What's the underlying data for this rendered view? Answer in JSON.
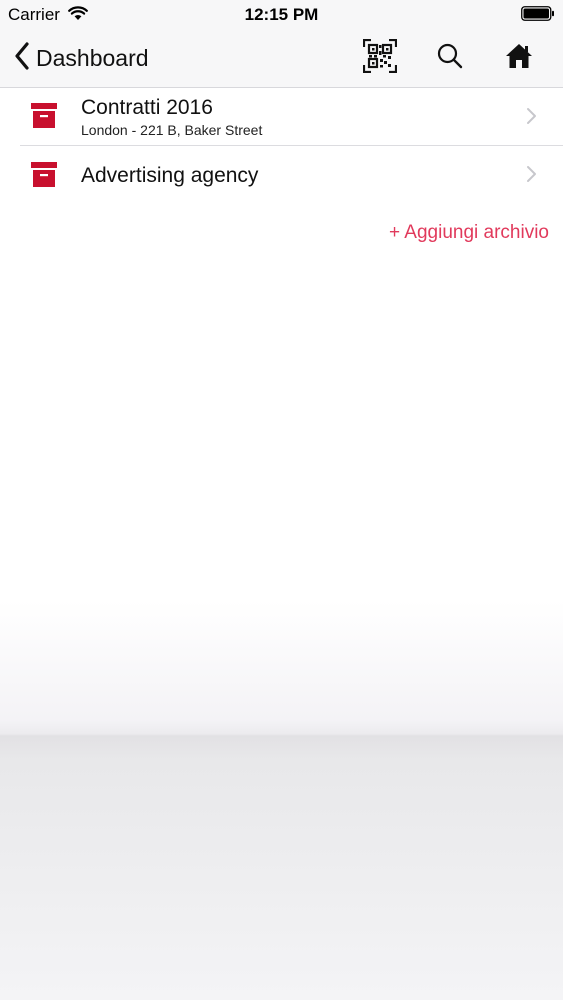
{
  "status_bar": {
    "carrier": "Carrier",
    "time": "12:15 PM"
  },
  "nav": {
    "back_label": "Dashboard",
    "icons": [
      "qr-code-icon",
      "search-icon",
      "home-icon"
    ]
  },
  "archives": [
    {
      "title": "Contratti 2016",
      "subtitle": "London - 221 B, Baker Street",
      "icon": "archive-box-icon"
    },
    {
      "title": "Advertising agency",
      "subtitle": "",
      "icon": "archive-box-icon"
    }
  ],
  "add_archive_label": "+ Aggiungi archivio",
  "colors": {
    "accent": "#e13a5c",
    "icon_red": "#c8102e",
    "nav_background": "#f7f7f8"
  }
}
